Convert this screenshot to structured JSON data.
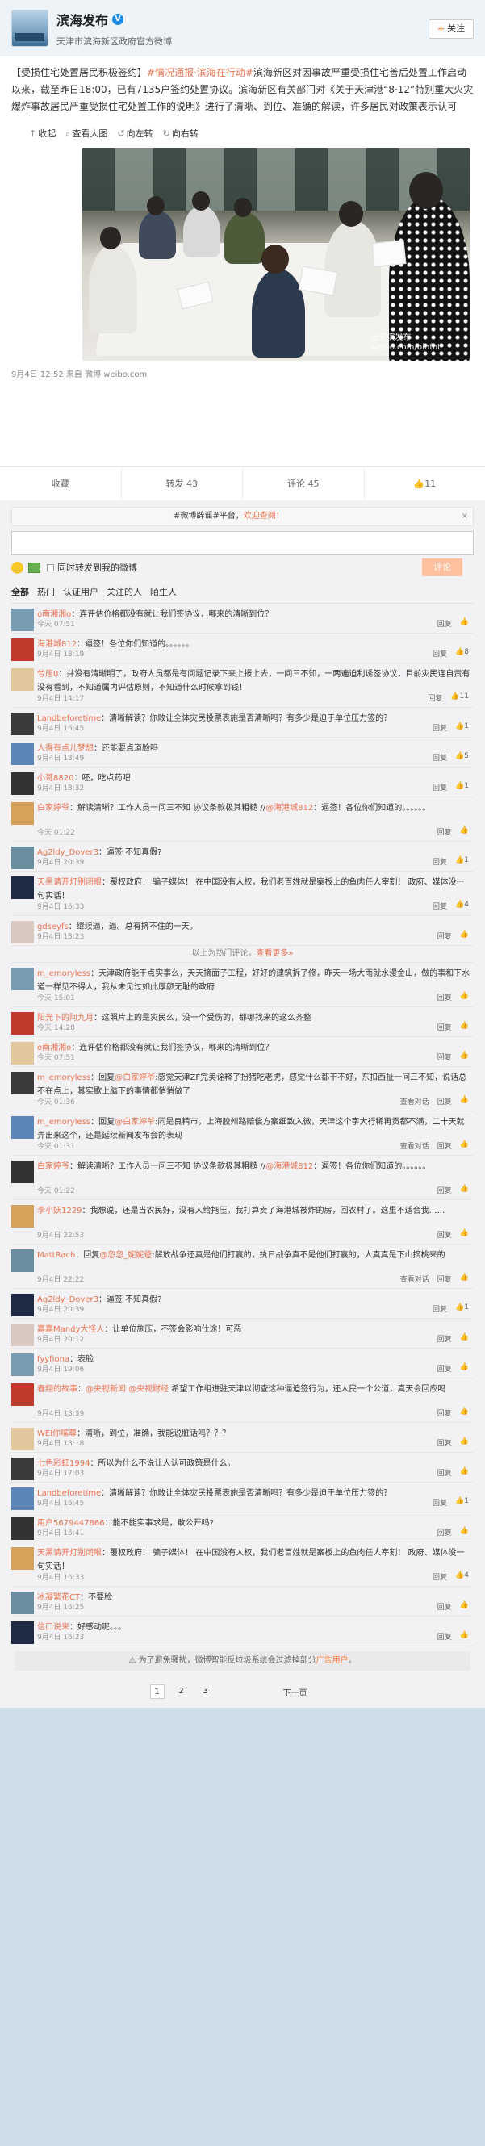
{
  "profile": {
    "name": "滨海发布",
    "verified_mark": "V",
    "desc": "天津市滨海新区政府官方微博",
    "follow_label": "关注",
    "follow_plus": "+"
  },
  "post": {
    "text_pre": "【受损住宅处置居民积极签约】",
    "tag1": "#情况通报·滨海在行动#",
    "text_mid": "滨海新区对因事故严重受损住宅善后处置工作启动以来，截至昨日18:00，已有7135户签约处置协议。滨海新区有关部门对《关于天津港“8·12”特别重大火灾爆炸事故居民严重受损住宅处置工作的说明》进行了清晰、到位、准确的解读，许多居民对政策表示认可",
    "media": [
      "收起",
      "查看大图",
      "向左转",
      "向右转"
    ],
    "watermark_line1": "@天滨发布",
    "watermark_line2": "weibo.com/binfbt",
    "meta": "9月4日 12:52 来自 微博 weibo.com"
  },
  "actions": [
    "收藏",
    "转发 43",
    "评论 45",
    "11"
  ],
  "compose": {
    "tagbar": "#微博辟谣#平台，",
    "tagbar_hl": "欢迎查阅！",
    "close": "×",
    "same_time": "同时转发到我的微博",
    "submit": "评论"
  },
  "tabs": [
    "全部",
    "热门",
    "认证用户",
    "关注的人",
    "陌生人"
  ],
  "comments_hot": [
    {
      "user": "o南湘湘o",
      "text": "：连评估价格都没有就让我们签协议，哪来的清晰到位？",
      "time": "今天 07:51",
      "acts": [
        "回复",
        ""
      ]
    },
    {
      "user": "海港城812",
      "text": "：逼签！各位你们知道的。。。。。。",
      "time": "9月4日 13:19",
      "acts": [
        "回复",
        "8"
      ]
    },
    {
      "user": "兮居0",
      "text": "：并没有清晰明了，政府人员都是有问题记录下来上报上去，一问三不知，一两遍迫利诱签协议，目前灾民连自责有没有看到，不知道属内评估原则，不知道什么时候拿到钱！",
      "time": "9月4日 14:17",
      "acts": [
        "回复",
        "11"
      ]
    },
    {
      "user": "Landbeforetime",
      "text": "：清晰解读？你敢让全体灾民投票表施是否清晰吗？有多少是迫于单位压力签的？",
      "time": "9月4日 16:45",
      "acts": [
        "回复",
        "1"
      ]
    },
    {
      "user": "人得有点儿梦想",
      "text": "：还能要点道脸吗",
      "time": "9月4日 13:49",
      "acts": [
        "回复",
        "5"
      ]
    },
    {
      "user": "小哥8820",
      "text": "：呸，吃点药吧",
      "time": "9月4日 13:32",
      "acts": [
        "回复",
        "1"
      ]
    },
    {
      "user": "白家婷爷",
      "text": "：解读清晰？工作人员一问三不知 协议条款极其粗糙 //",
      "mention": "@海港城812",
      "text2": "：逼签！各位你们知道的。。。。。。",
      "time": "今天 01:22",
      "acts": [
        "回复",
        ""
      ]
    },
    {
      "user": "Ag2ldy_Dover3",
      "text": "：逼签 不知真假?",
      "time": "9月4日 20:39",
      "acts": [
        "回复",
        "1"
      ]
    },
    {
      "user": "天黑请开灯别闭眼",
      "text": "：覆权政府！ 骗子媒体！ 在中国没有人权，我们老百姓就是案板上的鱼肉任人宰割！ 政府、媒体没一句实话！",
      "time": "9月4日 16:33",
      "acts": [
        "回复",
        "4"
      ]
    },
    {
      "user": "gdseyfs",
      "text": "：继续逼，逼。总有挤不住的一天。",
      "time": "9月4日 13:23",
      "acts": [
        "回复",
        ""
      ]
    }
  ],
  "divider": {
    "text": "以上为热门评论，",
    "more": "查看更多»"
  },
  "comments_all": [
    {
      "user": "m_emoryless",
      "text": "：天津政府能干点实事么，天天摘面子工程，好好的建筑拆了修，昨天一场大雨就水漫金山，做的事和下水道一样见不得人，我从未见过如此厚颜无耻的政府",
      "time": "今天 15:01",
      "acts": [
        "回复",
        ""
      ]
    },
    {
      "user": "阳光下的阿九月",
      "text": "：这照片上的是灾民么，没一个受伤的，都哪找来的这么齐整",
      "time": "今天 14:28",
      "acts": [
        "回复",
        ""
      ]
    },
    {
      "user": "o南湘湘o",
      "text": "：连评估价格都没有就让我们签协议，哪来的清晰到位？",
      "time": "今天 07:51",
      "acts": [
        "回复",
        ""
      ]
    },
    {
      "user": "m_emoryless",
      "text": "：回复",
      "mention": "@白家婷爷",
      "text2": ":感觉天津ZF完美诠释了扮猪吃老虎，感觉什么都干不好，东扣西扯一问三不知，说话总不在点上，其实歇上脑下的事情都悄悄做了",
      "time": "今天 01:36",
      "acts": [
        "查看对话",
        "回复",
        ""
      ]
    },
    {
      "user": "m_emoryless",
      "text": "：回复",
      "mention": "@白家婷爷",
      "text2": ":同是良精市，上海胶州路赔偿方案细致入微，天津这个字大行稀再贡都不满，二十天就弄出来这个，还是延续新闻发布会的表现",
      "time": "今天 01:31",
      "acts": [
        "查看对话",
        "回复",
        ""
      ]
    },
    {
      "user": "白家婷爷",
      "text": "：解读清晰？工作人员一问三不知 协议条款极其粗糙 //",
      "mention": "@海港城812",
      "text2": "：逼签！各位你们知道的。。。。。。",
      "time": "今天 01:22",
      "acts": [
        "回复",
        ""
      ]
    },
    {
      "user": "李小妖1229",
      "text": "：我想说，还是当农民好，没有人给拖压。我打算卖了海港城被炸的房，回农村了。这里不适合我……",
      "time": "9月4日 22:53",
      "acts": [
        "回复",
        ""
      ]
    },
    {
      "user": "MattRach",
      "text": "：回复",
      "mention": "@忽忽_妮妮爸",
      "text2": ":解放战争还真是他们打赢的，执日战争真不是他们打赢的，人真真是下山摘桃来的",
      "time": "9月4日 22:22",
      "acts": [
        "查看对话",
        "回复",
        ""
      ]
    },
    {
      "user": "Ag2ldy_Dover3",
      "text": "：逼签 不知真假?",
      "time": "9月4日 20:39",
      "acts": [
        "回复",
        "1"
      ]
    },
    {
      "user": "嘉嘉Mandy大怪人",
      "text": "：让单位施压，不签会影响仕途！可惡",
      "time": "9月4日 20:12",
      "acts": [
        "回复",
        ""
      ]
    },
    {
      "user": "fyyfiona",
      "text": "：表脸",
      "time": "9月4日 19:06",
      "acts": [
        "回复",
        ""
      ]
    },
    {
      "user": "春翔的故事",
      "text": "：",
      "mention": "@央视新闻 @央视财经",
      "text2": " 希望工作组进驻天津以彻查这种逼迫签行为，还人民一个公道，真天会回应吗",
      "time": "9月4日 18:39",
      "acts": [
        "回复",
        ""
      ]
    },
    {
      "user": "WEI你嘴尊",
      "text": "：清晰，到位，准确，我能说脏话吗？？？",
      "time": "9月4日 18:18",
      "acts": [
        "回复",
        ""
      ]
    },
    {
      "user": "七色彩虹1994",
      "text": "：所以为什么不说让人认可政策是什么。",
      "time": "9月4日 17:03",
      "acts": [
        "回复",
        ""
      ]
    },
    {
      "user": "Landbeforetime",
      "text": "：清晰解读？你敢让全体灾民投票表施是否清晰吗？有多少是迫于单位压力签的？",
      "time": "9月4日 16:45",
      "acts": [
        "回复",
        "1"
      ]
    },
    {
      "user": "用户5679447866",
      "text": "：能不能实事求是，敢公开吗?",
      "time": "9月4日 16:41",
      "acts": [
        "回复",
        ""
      ]
    },
    {
      "user": "天黑请开灯别闭眼",
      "text": "：覆权政府！ 骗子媒体！ 在中国没有人权，我们老百姓就是案板上的鱼肉任人宰割！ 政府、媒体没一句实话！",
      "time": "9月4日 16:33",
      "acts": [
        "回复",
        "4"
      ]
    },
    {
      "user": "冰凝繁花CT",
      "text": "：不要脸",
      "time": "9月4日 16:25",
      "acts": [
        "回复",
        ""
      ]
    },
    {
      "user": "信口说来",
      "text": "：好感动呢。。。",
      "time": "9月4日 16:23",
      "acts": [
        "回复",
        ""
      ]
    }
  ],
  "notice": {
    "pre": "为了避免骚扰，微博智能反垃圾系统会过滤掉部分",
    "hl": "广告用户",
    "post": "。"
  },
  "pager": {
    "pages": [
      "1",
      "2",
      "3"
    ],
    "next": "下一页"
  },
  "colors": {
    "accent": "#eb7350",
    "background": "#cfdde8"
  }
}
